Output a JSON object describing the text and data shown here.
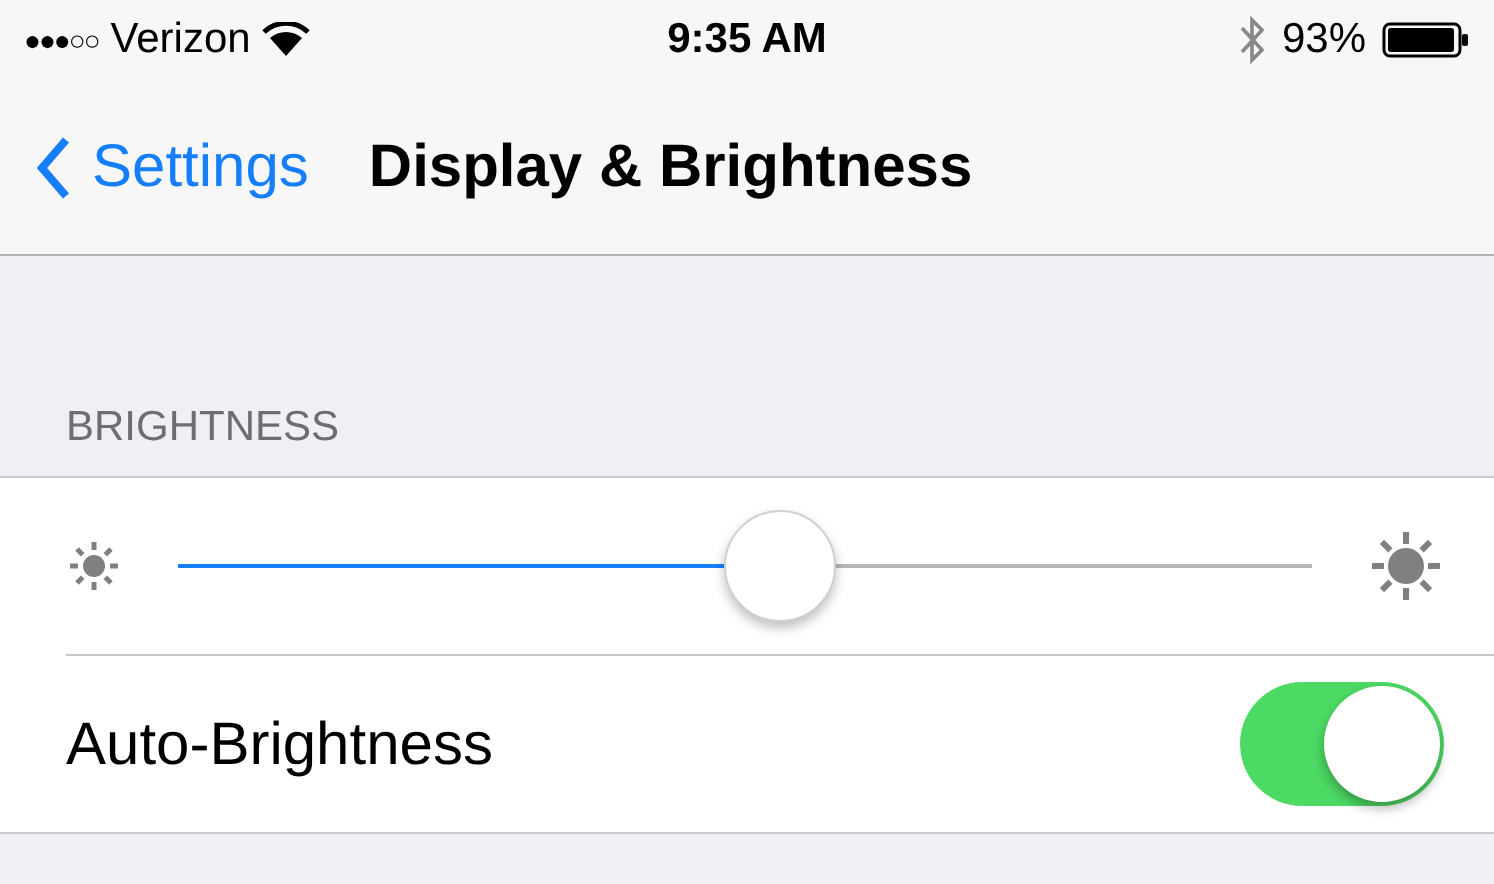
{
  "status_bar": {
    "signal": "●●●○○",
    "carrier": "Verizon",
    "time": "9:35 AM",
    "battery": "93%"
  },
  "nav": {
    "back": "Settings",
    "title": "Display & Brightness"
  },
  "section": {
    "header": "BRIGHTNESS"
  },
  "slider": {
    "level": 0.53
  },
  "toggle": {
    "label": "Auto-Brightness",
    "on": true
  }
}
